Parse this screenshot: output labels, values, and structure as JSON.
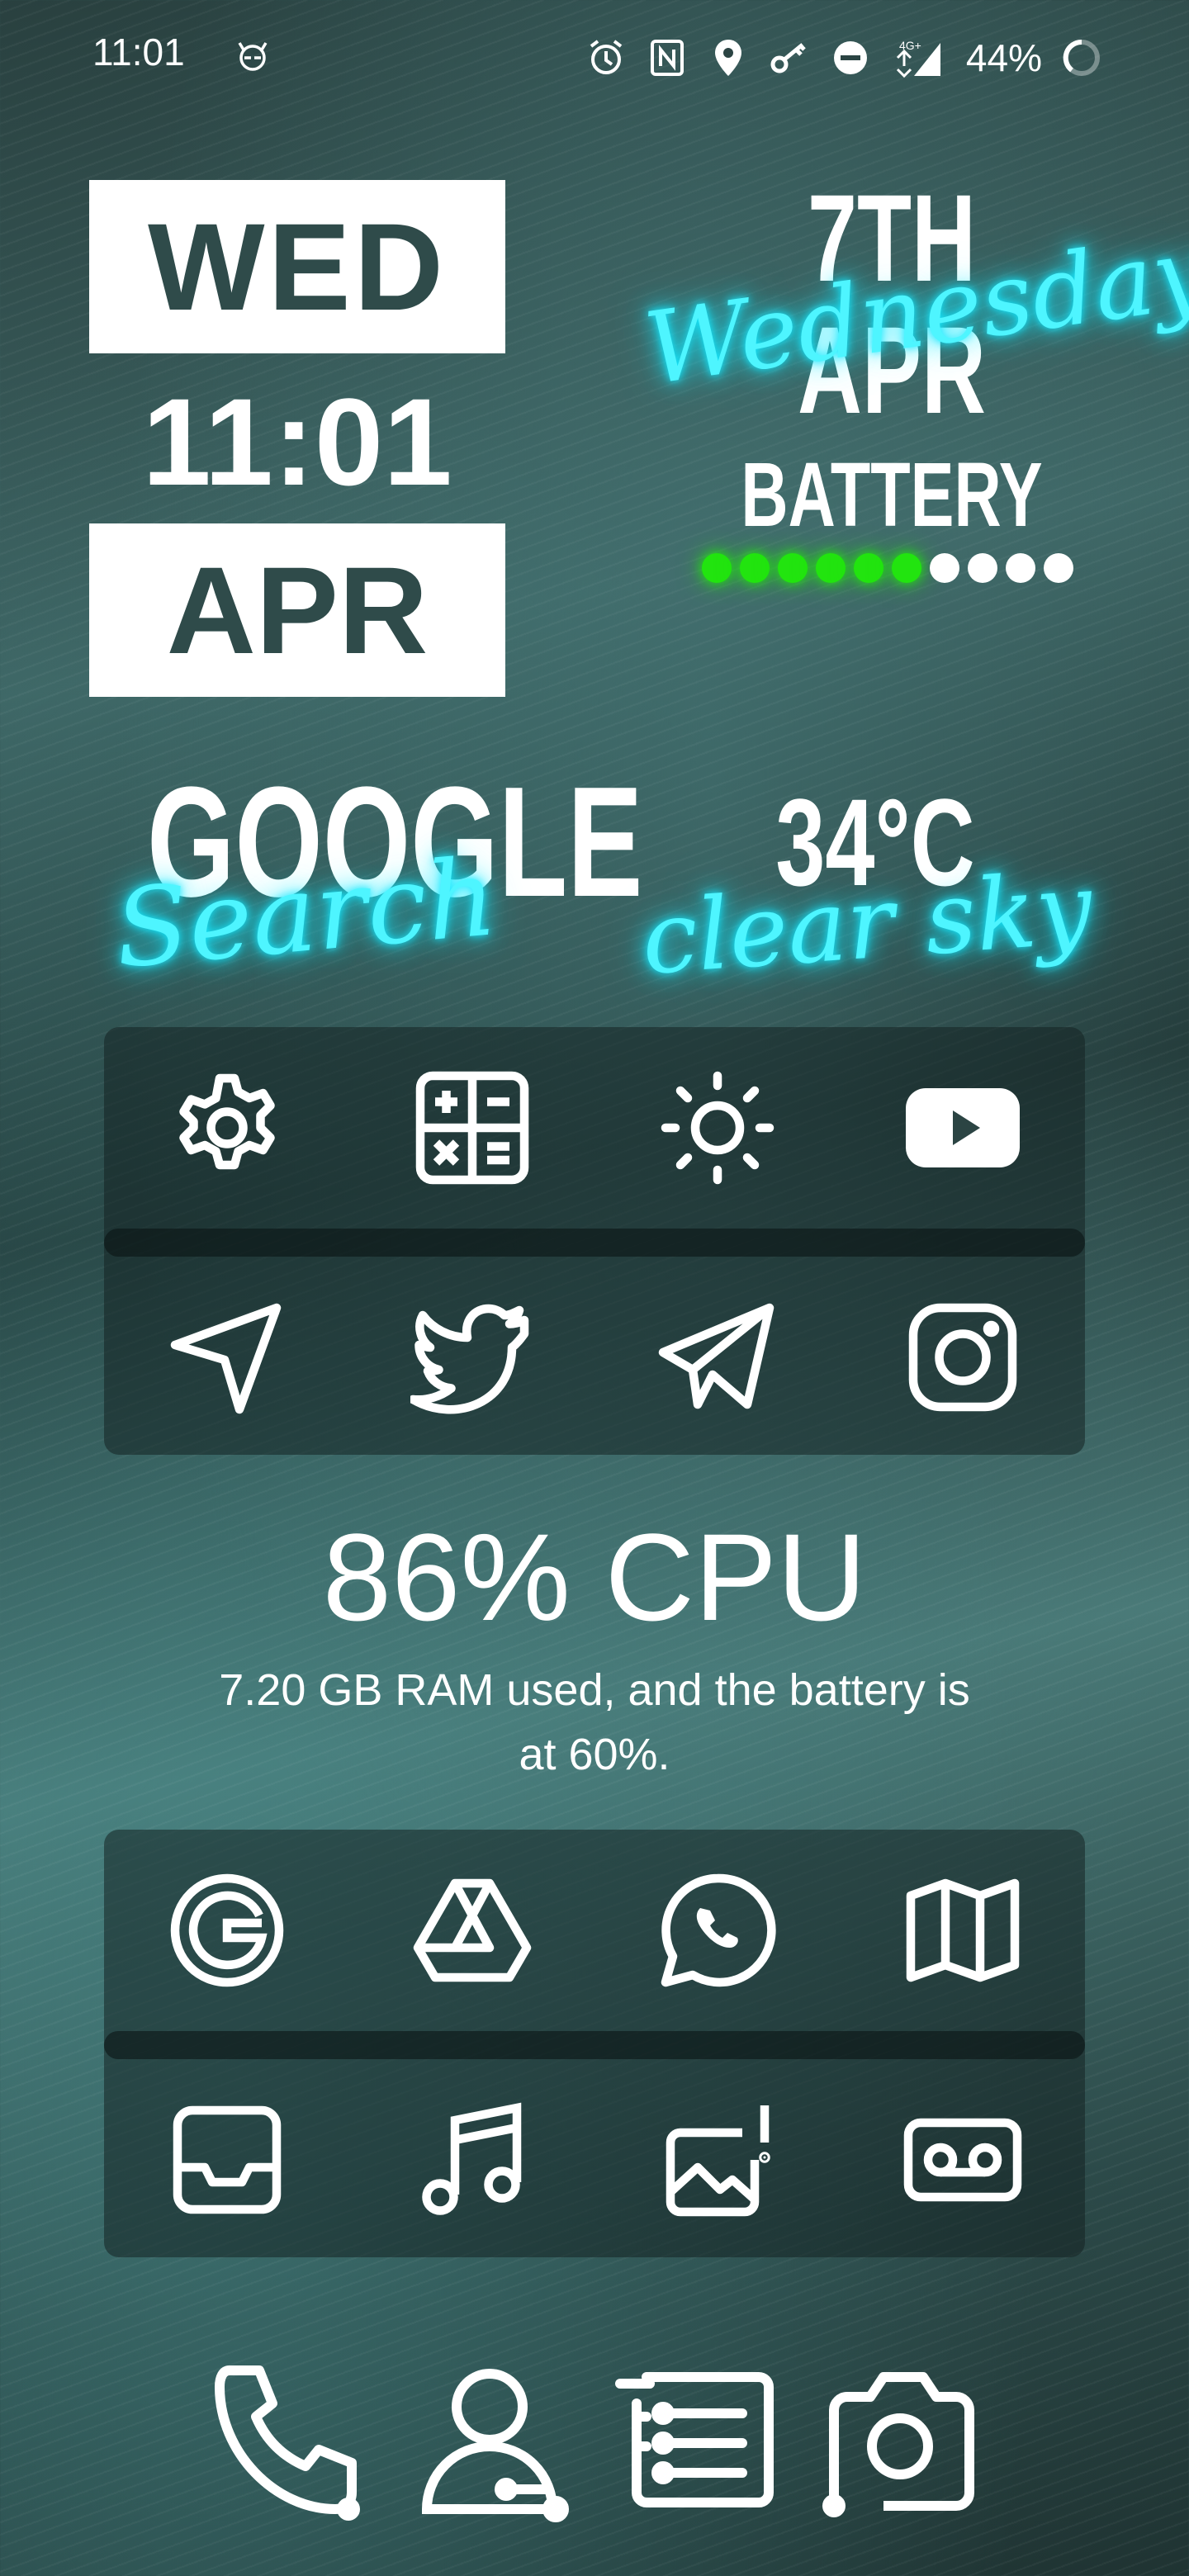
{
  "status_bar": {
    "time": "11:01",
    "battery_percent": "44%",
    "network": "4G+",
    "icons": [
      "cat-notification-icon",
      "alarm-icon",
      "nfc-icon",
      "location-icon",
      "vpn-key-icon",
      "do-not-disturb-icon",
      "signal-icon",
      "battery-ring-icon"
    ]
  },
  "date_widget": {
    "day": "WED",
    "time": "11:01",
    "month": "APR"
  },
  "date_text": {
    "title": "7TH APR",
    "script": "Wednesday"
  },
  "battery_widget": {
    "title": "BATTERY",
    "level": 0.6,
    "dots_total": 10,
    "dots_on": 6,
    "on_color": "#22e40f"
  },
  "google_widget": {
    "title": "GOOGLE",
    "script": "Search"
  },
  "weather_widget": {
    "temp": "34°C",
    "condition": "clear sky"
  },
  "app_panel_top": {
    "row1": [
      "settings-icon",
      "calculator-icon",
      "brightness-icon",
      "youtube-icon"
    ],
    "row2": [
      "navigation-arrow-icon",
      "twitter-icon",
      "telegram-icon",
      "instagram-icon"
    ]
  },
  "cpu_widget": {
    "title": "86% CPU",
    "subtitle": "7.20 GB RAM used, and the battery is at 60%."
  },
  "app_panel_bottom": {
    "row1": [
      "google-icon",
      "google-drive-icon",
      "whatsapp-icon",
      "map-icon"
    ],
    "row2": [
      "inbox-icon",
      "music-icon",
      "gallery-icon",
      "voicemail-icon"
    ]
  },
  "dock": [
    "phone-icon",
    "contacts-icon",
    "messages-icon",
    "camera-icon"
  ],
  "accent_color": "#4ef5ff"
}
